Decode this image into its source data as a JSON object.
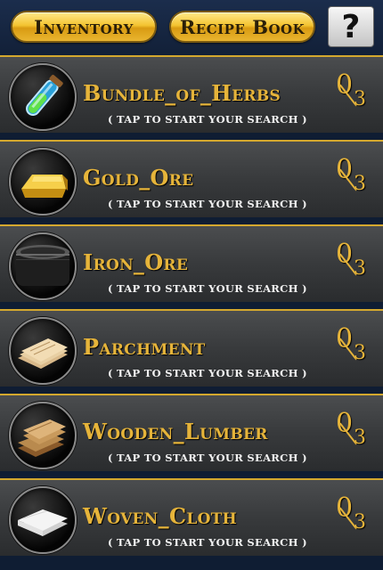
{
  "header": {
    "inventory_label": "Inventory",
    "recipe_label": "Recipe Book",
    "help_label": "?"
  },
  "items": [
    {
      "name": "Bundle_of_Herbs",
      "hint": "( TAP TO START YOUR SEARCH )",
      "found": "0",
      "needed": "3",
      "icon": "potion-vial-icon"
    },
    {
      "name": "Gold_Ore",
      "hint": "( TAP TO START YOUR SEARCH )",
      "found": "0",
      "needed": "3",
      "icon": "gold-bar-icon"
    },
    {
      "name": "Iron_Ore",
      "hint": "( TAP TO START YOUR SEARCH )",
      "found": "0",
      "needed": "3",
      "icon": "iron-ingot-icon"
    },
    {
      "name": "Parchment",
      "hint": "( TAP TO START YOUR SEARCH )",
      "found": "0",
      "needed": "3",
      "icon": "parchment-icon"
    },
    {
      "name": "Wooden_Lumber",
      "hint": "( TAP TO START YOUR SEARCH )",
      "found": "0",
      "needed": "3",
      "icon": "lumber-icon"
    },
    {
      "name": "Woven_Cloth",
      "hint": "( TAP TO START YOUR SEARCH )",
      "found": "0",
      "needed": "3",
      "icon": "cloth-icon"
    }
  ]
}
